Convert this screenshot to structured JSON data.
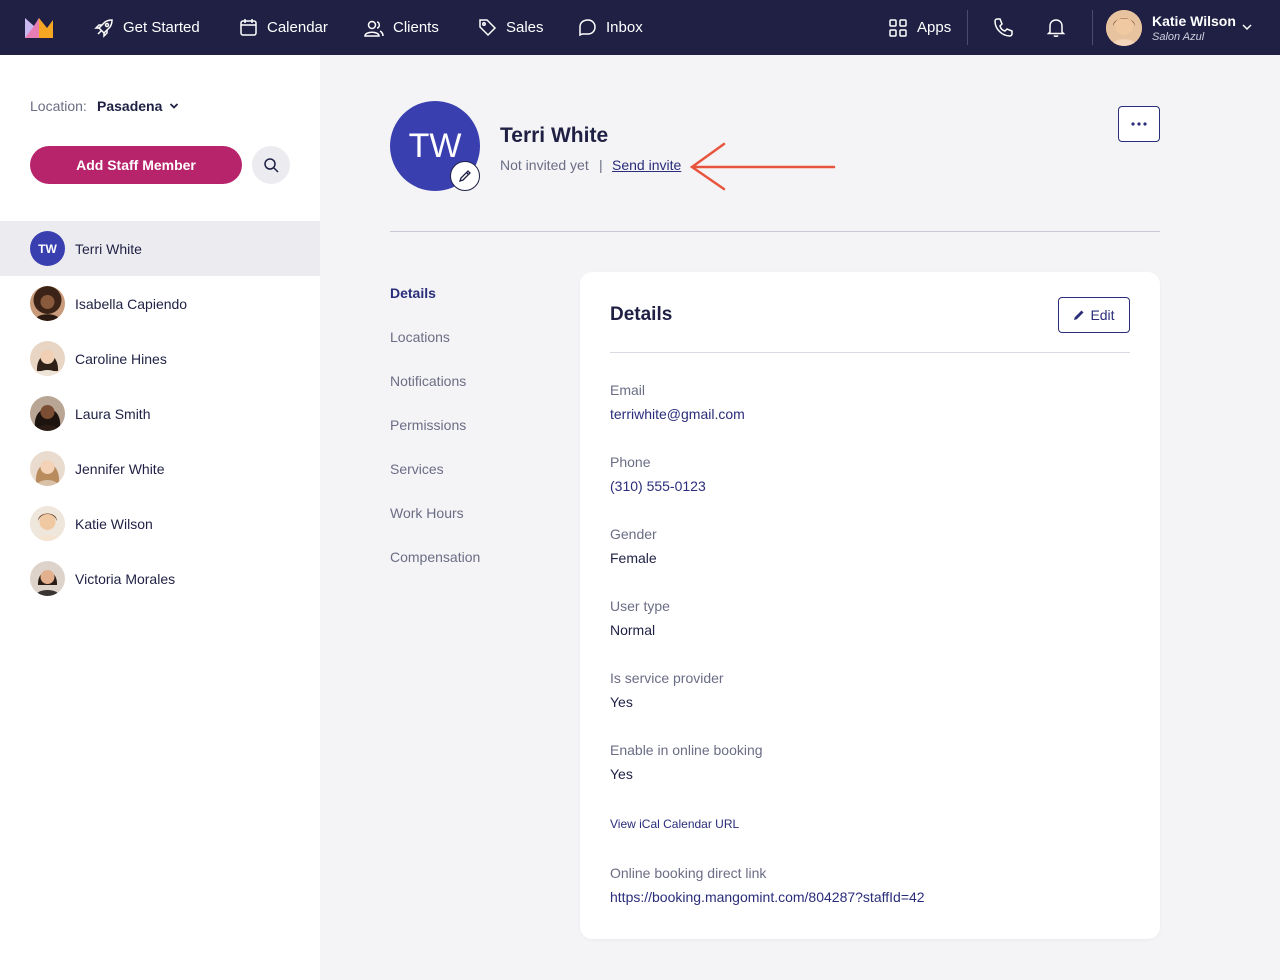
{
  "nav": {
    "items": [
      {
        "label": "Get Started",
        "icon": "rocket-icon"
      },
      {
        "label": "Calendar",
        "icon": "calendar-icon"
      },
      {
        "label": "Clients",
        "icon": "users-icon"
      },
      {
        "label": "Sales",
        "icon": "tag-icon"
      },
      {
        "label": "Inbox",
        "icon": "chat-icon"
      }
    ],
    "apps_label": "Apps",
    "user": {
      "name": "Katie Wilson",
      "org": "Salon Azul"
    }
  },
  "sidebar": {
    "location_label": "Location:",
    "location_value": "Pasadena",
    "add_button": "Add Staff Member",
    "staff": [
      {
        "name": "Terri White",
        "initials": "TW",
        "active": true
      },
      {
        "name": "Isabella Capiendo"
      },
      {
        "name": "Caroline Hines"
      },
      {
        "name": "Laura Smith"
      },
      {
        "name": "Jennifer White"
      },
      {
        "name": "Katie Wilson"
      },
      {
        "name": "Victoria Morales"
      }
    ]
  },
  "profile": {
    "initials": "TW",
    "name": "Terri White",
    "invite_status": "Not invited yet",
    "separator": "|",
    "send_invite": "Send invite"
  },
  "subnav": [
    "Details",
    "Locations",
    "Notifications",
    "Permissions",
    "Services",
    "Work Hours",
    "Compensation"
  ],
  "details": {
    "title": "Details",
    "edit_label": "Edit",
    "email_label": "Email",
    "email": "terriwhite@gmail.com",
    "phone_label": "Phone",
    "phone": "(310) 555-0123",
    "gender_label": "Gender",
    "gender": "Female",
    "user_type_label": "User type",
    "user_type": "Normal",
    "provider_label": "Is service provider",
    "provider": "Yes",
    "online_label": "Enable in online booking",
    "online": "Yes",
    "ical_link": "View iCal Calendar URL",
    "booking_label": "Online booking direct link",
    "booking_link": "https://booking.mangomint.com/804287?staffId=42"
  },
  "colors": {
    "nav_bg": "#1f2044",
    "accent": "#b8246c",
    "primary": "#3a3fb0",
    "annotation": "#e8553e"
  }
}
